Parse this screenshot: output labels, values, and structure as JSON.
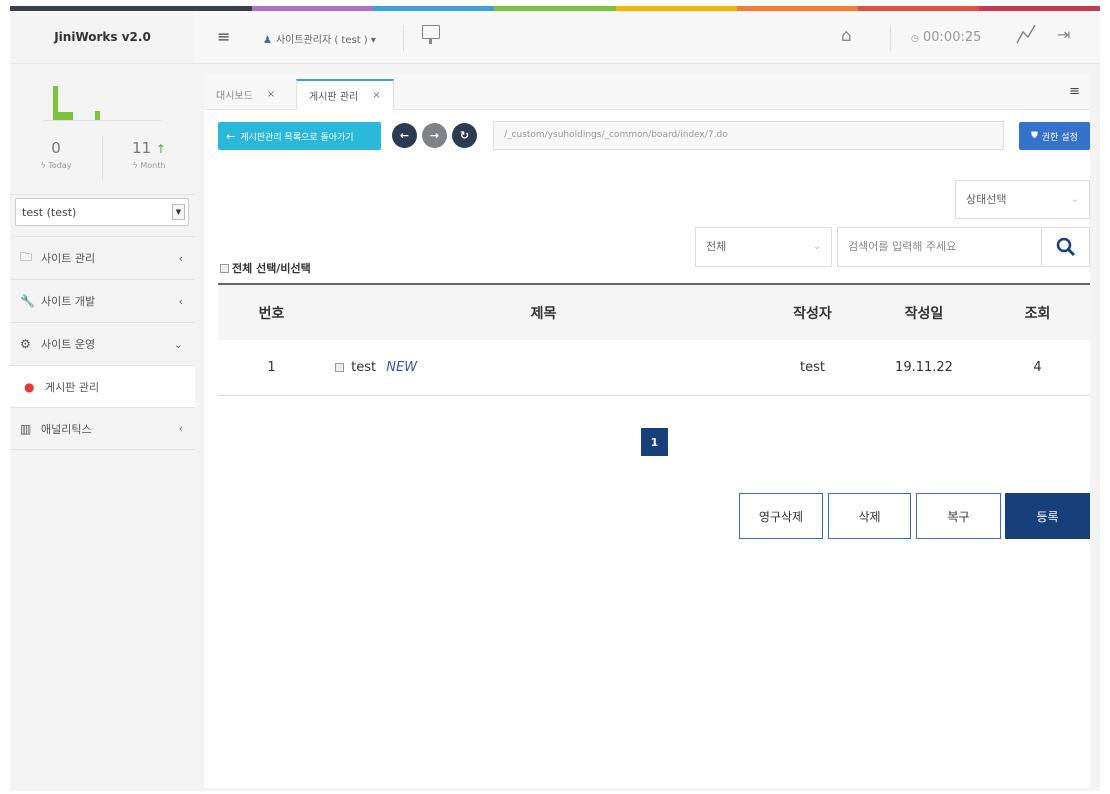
{
  "colors": {
    "rainbow": [
      "#3a3f4a",
      "#b070c8",
      "#3aa0e0",
      "#7cc241",
      "#f4b400",
      "#f08030",
      "#e05040",
      "#c04050"
    ],
    "brand_navy": "#173f7a",
    "accent_cyan": "#2bb7d9",
    "accent_blue": "#3572c9"
  },
  "app": {
    "title": "JiniWorks v2.0"
  },
  "topbar": {
    "user_label": "사이트관리자 ( test ) ▾",
    "timer": "00:00:25",
    "icons": [
      "hamburger-icon",
      "user-icon",
      "monitor-icon",
      "home-icon",
      "clock-icon",
      "graph-icon",
      "logout-icon"
    ]
  },
  "stats": {
    "today_value": "0",
    "today_label": "Today",
    "month_value": "11",
    "month_label": "Month"
  },
  "site_select": {
    "value": "test (test)"
  },
  "sidebar": {
    "items": [
      {
        "label": "사이트 관리",
        "icon": "folder-icon",
        "arrow": "‹"
      },
      {
        "label": "사이트 개발",
        "icon": "wrench-icon",
        "arrow": "‹"
      },
      {
        "label": "사이트 운영",
        "icon": "gears-icon",
        "arrow": "⌄"
      },
      {
        "label": "게시판 관리",
        "icon": "chat-bubble-icon",
        "arrow": ""
      },
      {
        "label": "애널리틱스",
        "icon": "bar-chart-icon",
        "arrow": "‹"
      }
    ]
  },
  "tabs": [
    {
      "label": "대시보드",
      "close": "×"
    },
    {
      "label": "게시판 관리",
      "close": "×"
    }
  ],
  "toolbar": {
    "back_label": "게시판관리 목록으로 돌아가기",
    "url": "/_custom/ysuholdings/_common/board/index/7.do",
    "permission_label": "권한 설정"
  },
  "filters": {
    "status_select": "상태선택",
    "select_all_label": "전체 선택/비선택",
    "field_select": "전체",
    "search_placeholder": "검색어를 입력해 주세요"
  },
  "table": {
    "headers": [
      "번호",
      "제목",
      "작성자",
      "작성일",
      "조회"
    ],
    "rows": [
      {
        "no": "1",
        "title": "test",
        "badge": "NEW",
        "author": "test",
        "date": "19.11.22",
        "views": "4"
      }
    ]
  },
  "pagination": {
    "current": "1"
  },
  "actions": {
    "perm_delete": "영구삭제",
    "delete": "삭제",
    "restore": "복구",
    "register": "등록"
  }
}
